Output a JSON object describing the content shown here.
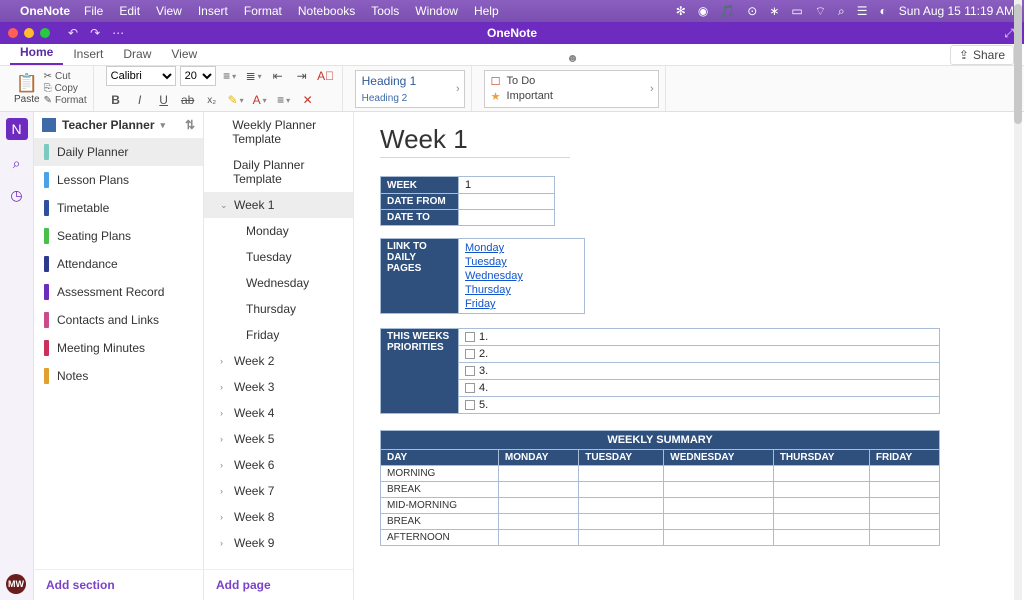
{
  "mac_menu": {
    "app": "OneNote",
    "items": [
      "File",
      "Edit",
      "View",
      "Insert",
      "Format",
      "Notebooks",
      "Tools",
      "Window",
      "Help"
    ],
    "clock": "Sun Aug 15  11:19 AM"
  },
  "window": {
    "title": "OneNote"
  },
  "ribbon_tabs": [
    "Home",
    "Insert",
    "Draw",
    "View"
  ],
  "active_tab": "Home",
  "share_label": "Share",
  "clipboard": {
    "paste": "Paste",
    "cut": "Cut",
    "copy": "Copy",
    "format": "Format"
  },
  "font": {
    "name": "Calibri",
    "size": "20"
  },
  "styles": {
    "h1": "Heading 1",
    "h2": "Heading 2"
  },
  "tags": {
    "todo": "To Do",
    "important": "Important"
  },
  "notebook": "Teacher Planner",
  "sections": [
    {
      "label": "Daily Planner",
      "color": "#7bc9c0",
      "selected": true
    },
    {
      "label": "Lesson Plans",
      "color": "#4aa3e8"
    },
    {
      "label": "Timetable",
      "color": "#2f4f9e"
    },
    {
      "label": "Seating Plans",
      "color": "#4bbf4b"
    },
    {
      "label": "Attendance",
      "color": "#2b3a8a"
    },
    {
      "label": "Assessment Record",
      "color": "#6d2bc0"
    },
    {
      "label": "Contacts and Links",
      "color": "#c94b8a"
    },
    {
      "label": "Meeting Minutes",
      "color": "#c9305a"
    },
    {
      "label": "Notes",
      "color": "#e0a030"
    }
  ],
  "add_section": "Add section",
  "pages": {
    "items": [
      {
        "label": "Weekly Planner Template",
        "level": 0
      },
      {
        "label": "Daily Planner Template",
        "level": 0
      },
      {
        "label": "Week 1",
        "level": 0,
        "expanded": true,
        "selected": true
      },
      {
        "label": "Monday",
        "level": 1
      },
      {
        "label": "Tuesday",
        "level": 1
      },
      {
        "label": "Wednesday",
        "level": 1
      },
      {
        "label": "Thursday",
        "level": 1
      },
      {
        "label": "Friday",
        "level": 1
      },
      {
        "label": "Week 2",
        "level": 0,
        "collapsible": true
      },
      {
        "label": "Week 3",
        "level": 0,
        "collapsible": true
      },
      {
        "label": "Week 4",
        "level": 0,
        "collapsible": true
      },
      {
        "label": "Week 5",
        "level": 0,
        "collapsible": true
      },
      {
        "label": "Week 6",
        "level": 0,
        "collapsible": true
      },
      {
        "label": "Week 7",
        "level": 0,
        "collapsible": true
      },
      {
        "label": "Week 8",
        "level": 0,
        "collapsible": true
      },
      {
        "label": "Week 9",
        "level": 0,
        "collapsible": true
      }
    ],
    "add_page": "Add page"
  },
  "page": {
    "title": "Week 1",
    "info_rows": [
      {
        "label": "WEEK",
        "value": "1"
      },
      {
        "label": "DATE FROM",
        "value": ""
      },
      {
        "label": "DATE TO",
        "value": ""
      }
    ],
    "links_label": "LINK TO DAILY PAGES",
    "day_links": [
      "Monday",
      "Tuesday",
      "Wednesday",
      "Thursday",
      "Friday"
    ],
    "priorities_label": "THIS WEEKS PRIORITIES",
    "priorities": [
      "1.",
      "2.",
      "3.",
      "4.",
      "5."
    ],
    "summary": {
      "title": "WEEKLY SUMMARY",
      "cols": [
        "DAY",
        "MONDAY",
        "TUESDAY",
        "WEDNESDAY",
        "THURSDAY",
        "FRIDAY"
      ],
      "rows": [
        "MORNING",
        "BREAK",
        "MID-MORNING",
        "BREAK",
        "AFTERNOON"
      ]
    }
  },
  "avatar": "MW"
}
